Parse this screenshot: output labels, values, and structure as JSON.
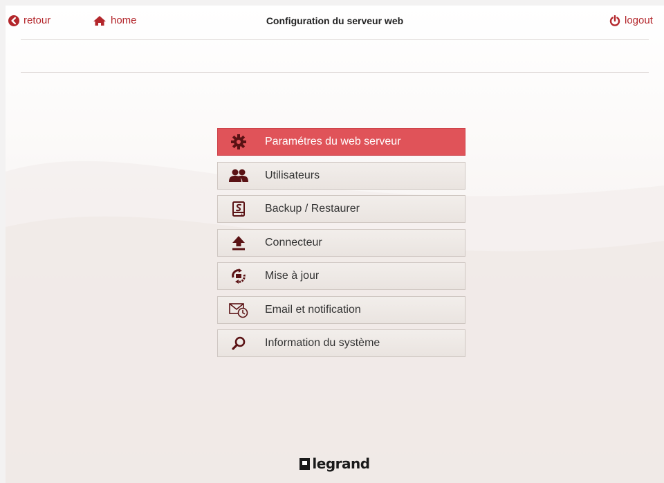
{
  "header": {
    "back_label": "retour",
    "home_label": "home",
    "title": "Configuration du serveur web",
    "logout_label": "logout"
  },
  "menu": {
    "items": [
      {
        "label": "Paramétres du web serveur",
        "icon": "gear-icon",
        "active": true
      },
      {
        "label": "Utilisateurs",
        "icon": "users-icon",
        "active": false
      },
      {
        "label": "Backup / Restaurer",
        "icon": "backup-icon",
        "active": false
      },
      {
        "label": "Connecteur",
        "icon": "upload-icon",
        "active": false
      },
      {
        "label": "Mise à jour",
        "icon": "update-icon",
        "active": false
      },
      {
        "label": "Email et notification",
        "icon": "email-clock-icon",
        "active": false
      },
      {
        "label": "Information du système",
        "icon": "search-icon",
        "active": false
      }
    ]
  },
  "footer": {
    "brand": "legrand"
  },
  "colors": {
    "accent": "#b3262b",
    "active_item": "#e05359",
    "icon_dark": "#5a1214"
  }
}
